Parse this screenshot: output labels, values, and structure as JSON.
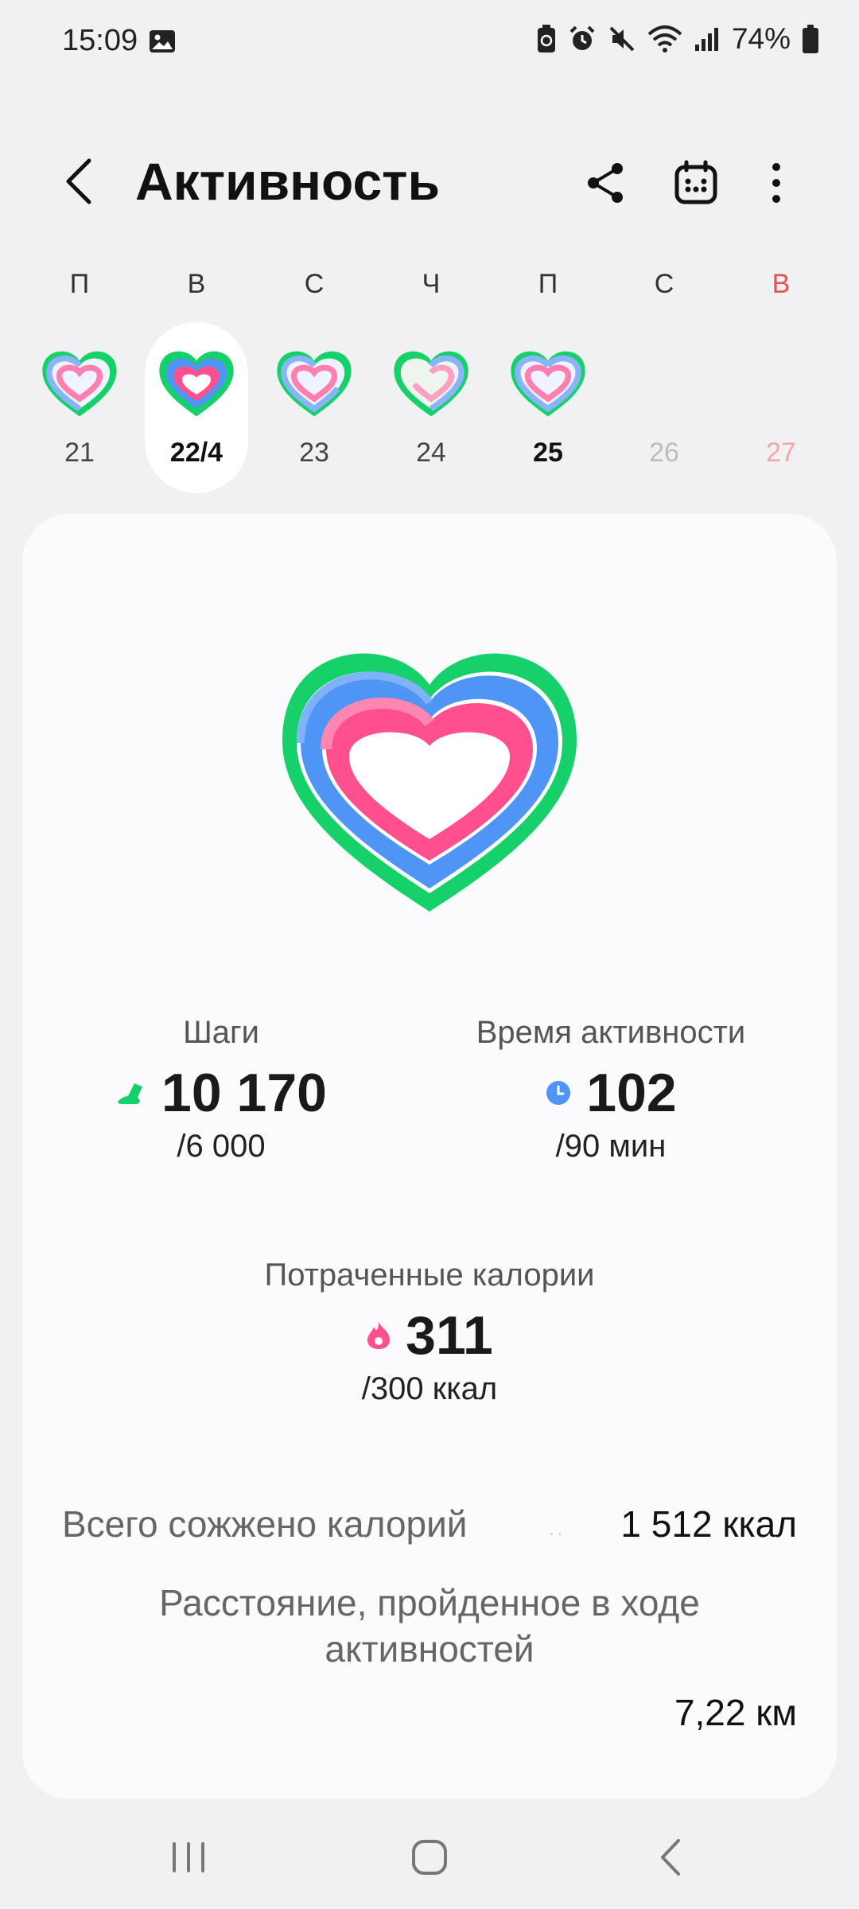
{
  "status_bar": {
    "time": "15:09",
    "battery": "74%"
  },
  "header": {
    "title": "Активность"
  },
  "week": [
    {
      "letter": "П",
      "date": "21",
      "state": "past"
    },
    {
      "letter": "В",
      "date": "22/4",
      "state": "selected"
    },
    {
      "letter": "С",
      "date": "23",
      "state": "past"
    },
    {
      "letter": "Ч",
      "date": "24",
      "state": "past"
    },
    {
      "letter": "П",
      "date": "25",
      "state": "today"
    },
    {
      "letter": "С",
      "date": "26",
      "state": "future"
    },
    {
      "letter": "В",
      "date": "27",
      "state": "future-sunday"
    }
  ],
  "stats": {
    "steps": {
      "label": "Шаги",
      "value": "10 170",
      "goal": "/6 000"
    },
    "active_time": {
      "label": "Время активности",
      "value": "102",
      "goal": "/90 мин"
    },
    "calories": {
      "label": "Потраченные калории",
      "value": "311",
      "goal": "/300 ккал"
    }
  },
  "summary": {
    "total_calories_label": "Всего сожжено калорий",
    "total_calories_value": "1 512 ккал",
    "distance_label": "Расстояние, пройденное в ходе активностей",
    "distance_value": "7,22 км"
  },
  "colors": {
    "steps_ring": "#16d16a",
    "time_ring": "#4e95f5",
    "calories_ring": "#ff4f8f",
    "sunday": "#e2544f"
  }
}
